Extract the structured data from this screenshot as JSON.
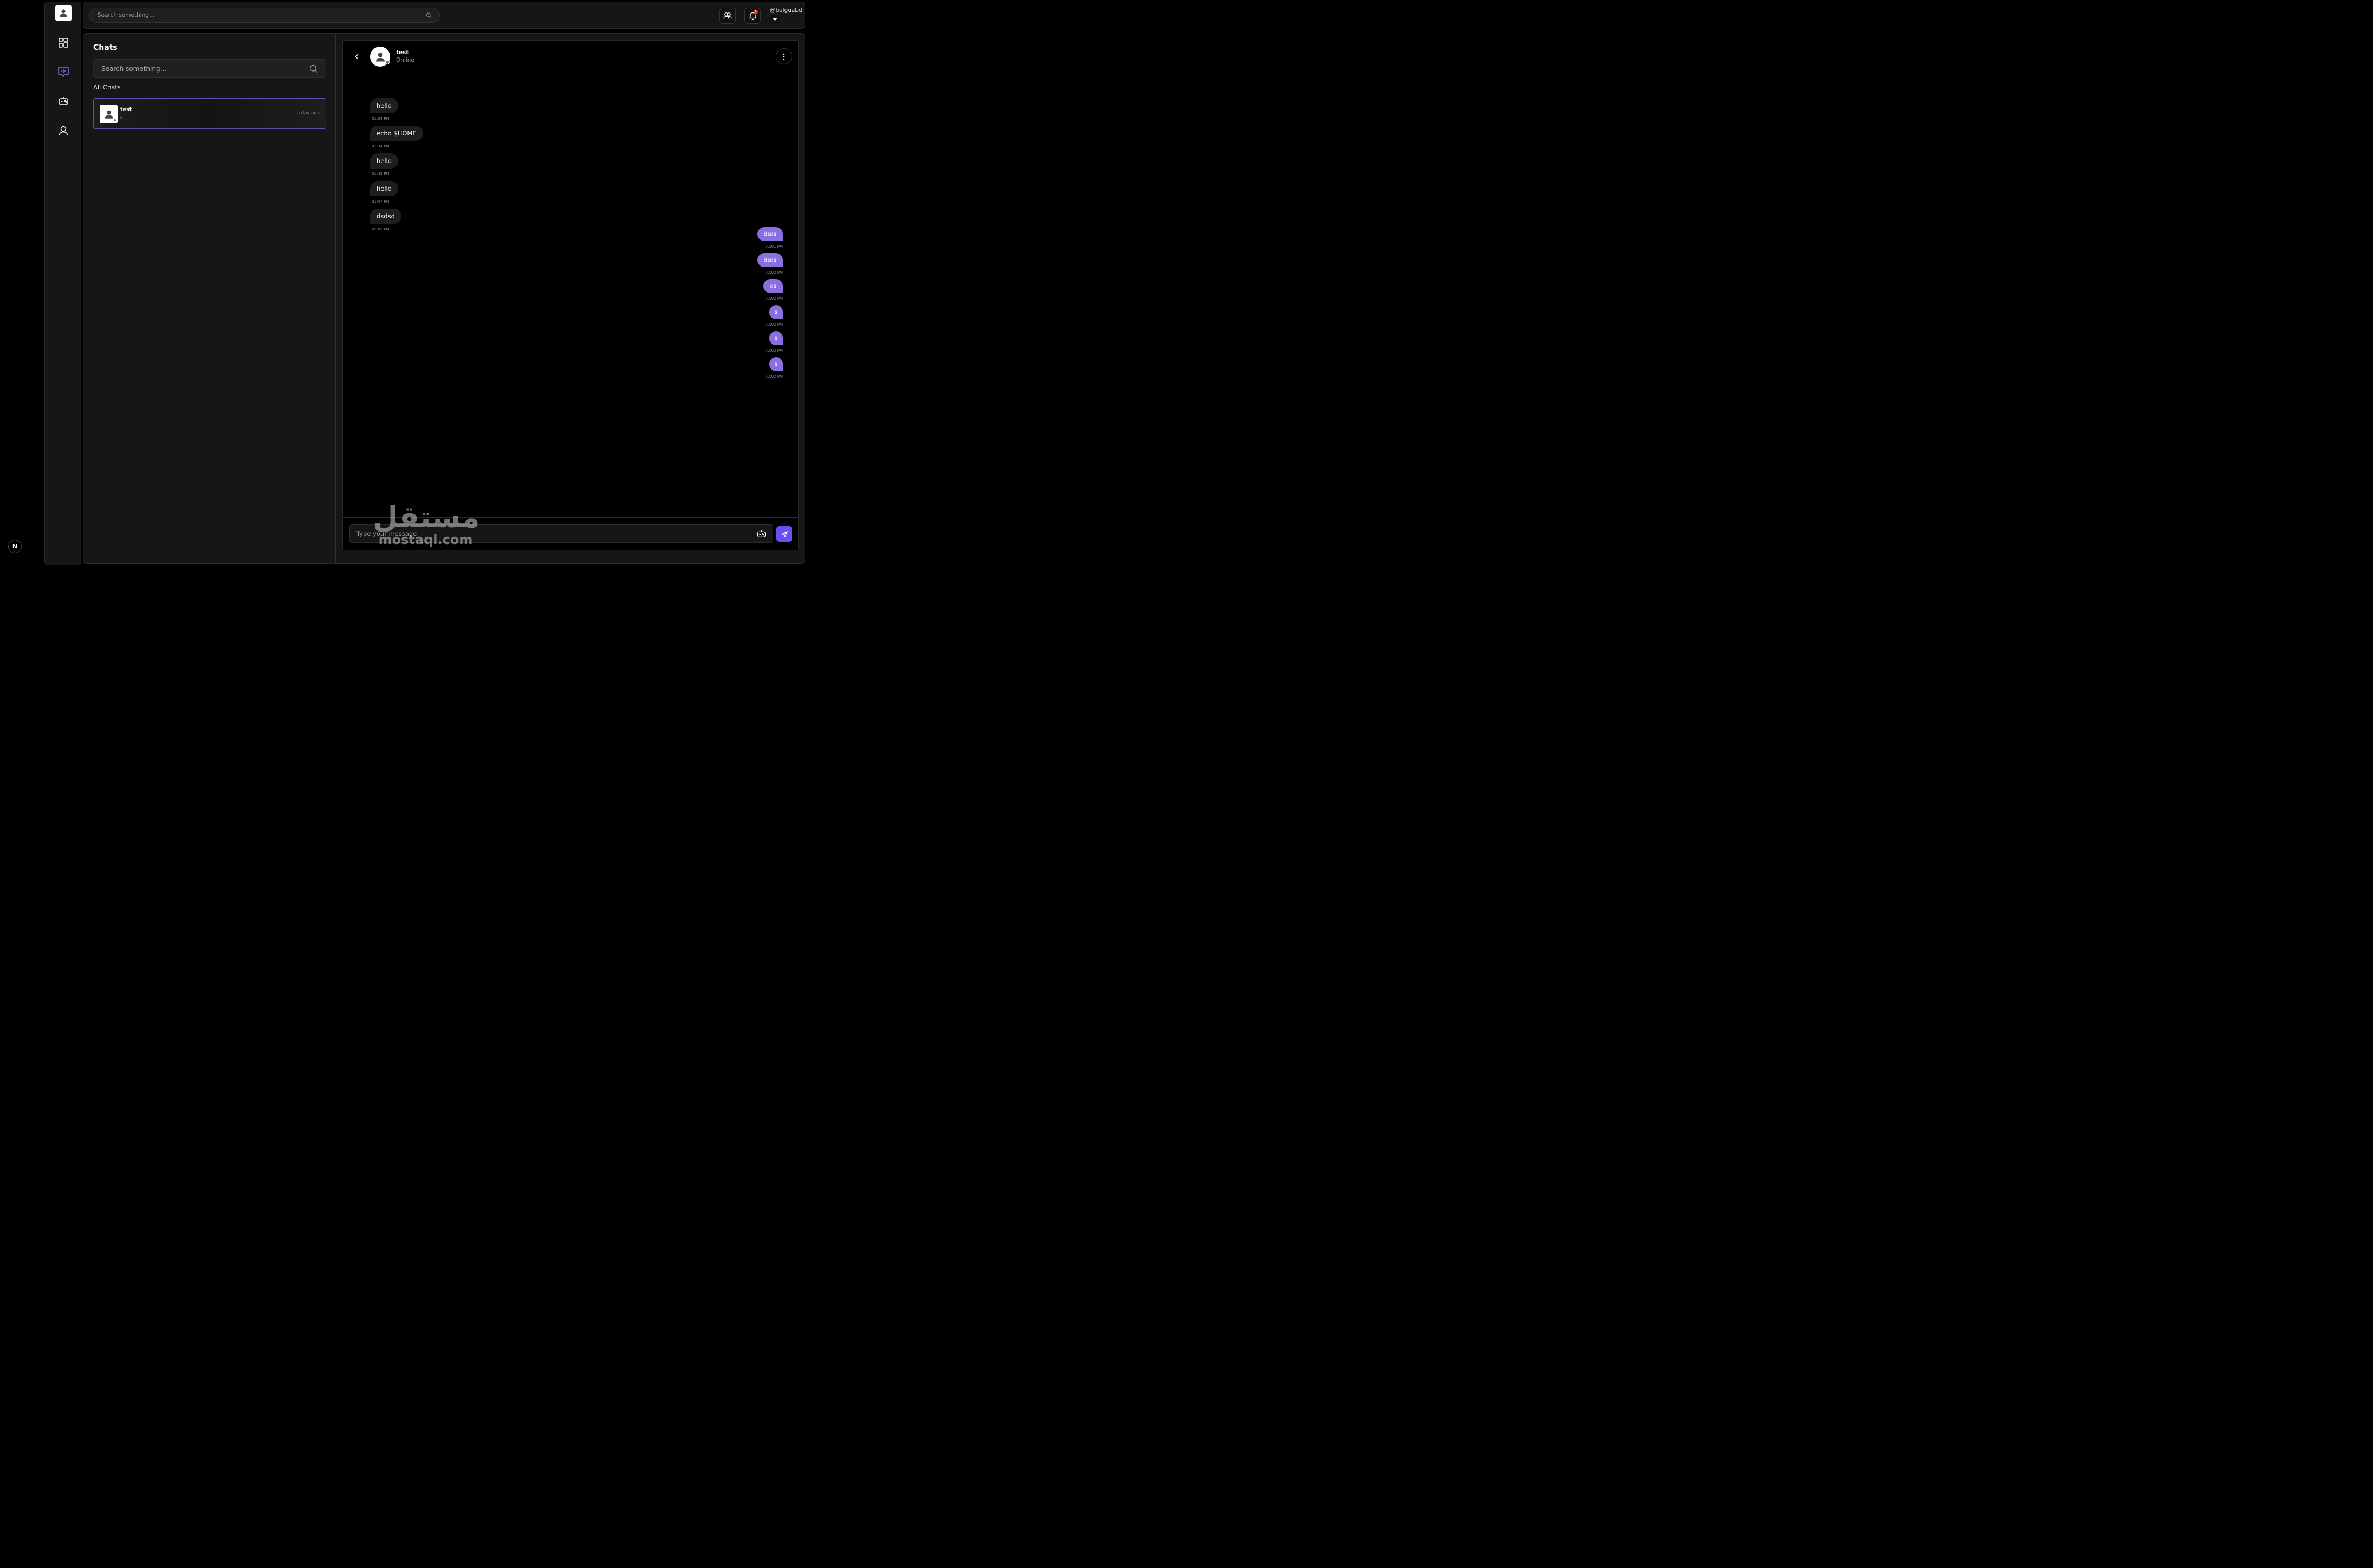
{
  "topbar": {
    "search_placeholder": "Search something...",
    "username": "@belguabd",
    "notification_count": "0"
  },
  "sidebar": {
    "items": [
      {
        "icon": "dashboard-icon"
      },
      {
        "icon": "chat-icon",
        "active": true
      },
      {
        "icon": "game-controller-icon"
      },
      {
        "icon": "profile-icon"
      }
    ],
    "accent": "#8a6fe0"
  },
  "chats_panel": {
    "title": "Chats",
    "search_placeholder": "Search something...",
    "section_label": "All Chats",
    "items": [
      {
        "name": "test",
        "last_message": "s",
        "time": "a day ago"
      }
    ]
  },
  "conversation": {
    "name": "test",
    "status": "Online",
    "messages": [
      {
        "direction": "in",
        "text": "hello",
        "time": "01:34 PM"
      },
      {
        "direction": "in",
        "text": "echo $HOME",
        "time": "01:34 PM"
      },
      {
        "direction": "in",
        "text": "hello",
        "time": "01:42 PM"
      },
      {
        "direction": "in",
        "text": "hello",
        "time": "01:47 PM"
      },
      {
        "direction": "in",
        "text": "dsdsd",
        "time": "02:01 PM"
      },
      {
        "direction": "out",
        "text": "dsds",
        "time": "02:01 PM"
      },
      {
        "direction": "out",
        "text": "dsds",
        "time": "02:02 PM"
      },
      {
        "direction": "out",
        "text": "ds",
        "time": "02:02 PM"
      },
      {
        "direction": "out",
        "text": "s",
        "time": "02:02 PM"
      },
      {
        "direction": "out",
        "text": "s",
        "time": "02:02 PM"
      },
      {
        "direction": "out",
        "text": "s",
        "time": "02:02 PM"
      }
    ],
    "composer_placeholder": "Type your message"
  },
  "watermark": {
    "arabic": "مستقل",
    "latin": "mostaql.com"
  },
  "framework_badge": "N",
  "colors": {
    "accent": "#8a6fe0",
    "send_button": "#6c4ef2",
    "notification_badge": "#e53935"
  }
}
